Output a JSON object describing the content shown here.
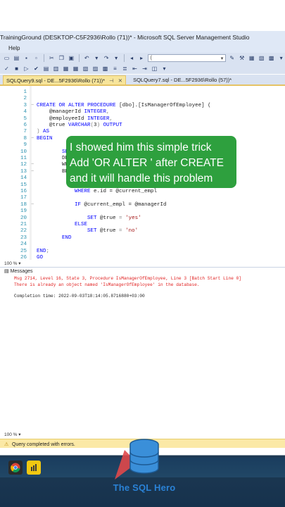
{
  "window": {
    "title": "TrainingGround (DESKTOP-C5F2936\\Rollo (71))* - Microsoft SQL Server Management Studio"
  },
  "menu": {
    "items": [
      "Help"
    ]
  },
  "toolbar": {
    "database_combo_value": "("
  },
  "tabs": [
    {
      "label": "SQLQuery9.sql - DE...5F2936\\Rollo (71))*",
      "active": true
    },
    {
      "label": "SQLQuery7.sql - DE...5F2936\\Rollo (57))*",
      "active": false
    }
  ],
  "editor": {
    "zoom": "100 %",
    "lines": [
      {
        "n": "1",
        "text": ""
      },
      {
        "n": "2",
        "text": ""
      },
      {
        "n": "3",
        "text": "CREATE OR ALTER PROCEDURE [dbo].[IsManagerOfEmployee] ("
      },
      {
        "n": "4",
        "text": "    @managerId INTEGER,"
      },
      {
        "n": "5",
        "text": "    @employeeId INTEGER,"
      },
      {
        "n": "6",
        "text": "    @true VARCHAR(3) OUTPUT"
      },
      {
        "n": "7",
        "text": ") AS"
      },
      {
        "n": "8",
        "text": "BEGIN"
      },
      {
        "n": "9",
        "text": ""
      },
      {
        "n": "10",
        "text": "        SET"
      },
      {
        "n": "11",
        "text": "        DEC"
      },
      {
        "n": "12",
        "text": "        WHI"
      },
      {
        "n": "13",
        "text": "        BEG"
      },
      {
        "n": "14",
        "text": ""
      },
      {
        "n": "15",
        "text": ""
      },
      {
        "n": "16",
        "text": "            WHERE e.id = @current_empl"
      },
      {
        "n": "17",
        "text": ""
      },
      {
        "n": "18",
        "text": "            IF @current_empl = @managerId"
      },
      {
        "n": "19",
        "text": ""
      },
      {
        "n": "20",
        "text": "                SET @true = 'yes'"
      },
      {
        "n": "21",
        "text": "            ELSE"
      },
      {
        "n": "22",
        "text": "                SET @true = 'no'"
      },
      {
        "n": "23",
        "text": "        END"
      },
      {
        "n": "24",
        "text": ""
      },
      {
        "n": "25",
        "text": "END;"
      },
      {
        "n": "26",
        "text": "GO"
      }
    ]
  },
  "messages": {
    "header": "Messages",
    "zoom": "100 %",
    "error_line1": "Msg 2714, Level 16, State 3, Procedure IsManagerOfEmployee, Line 3 [Batch Start Line 0]",
    "error_line2": "There is already an object named 'IsManagerOfEmployee' in the database.",
    "completion": "Completion time: 2022-09-03T18:14:05.8716880+03:00"
  },
  "status": {
    "text": "Query completed with errors."
  },
  "overlay": {
    "line1": "I showed him this simple trick",
    "line2": "Add  'OR ALTER ' after CREATE",
    "line3": "and it will handle this problem"
  },
  "watermark": {
    "text": "The SQL Hero"
  },
  "colors": {
    "overlay_bg": "#2ea03e",
    "error_text": "#e02020",
    "keyword": "#0000ff",
    "string": "#a31515",
    "status_bar": "#fbe9a6"
  }
}
